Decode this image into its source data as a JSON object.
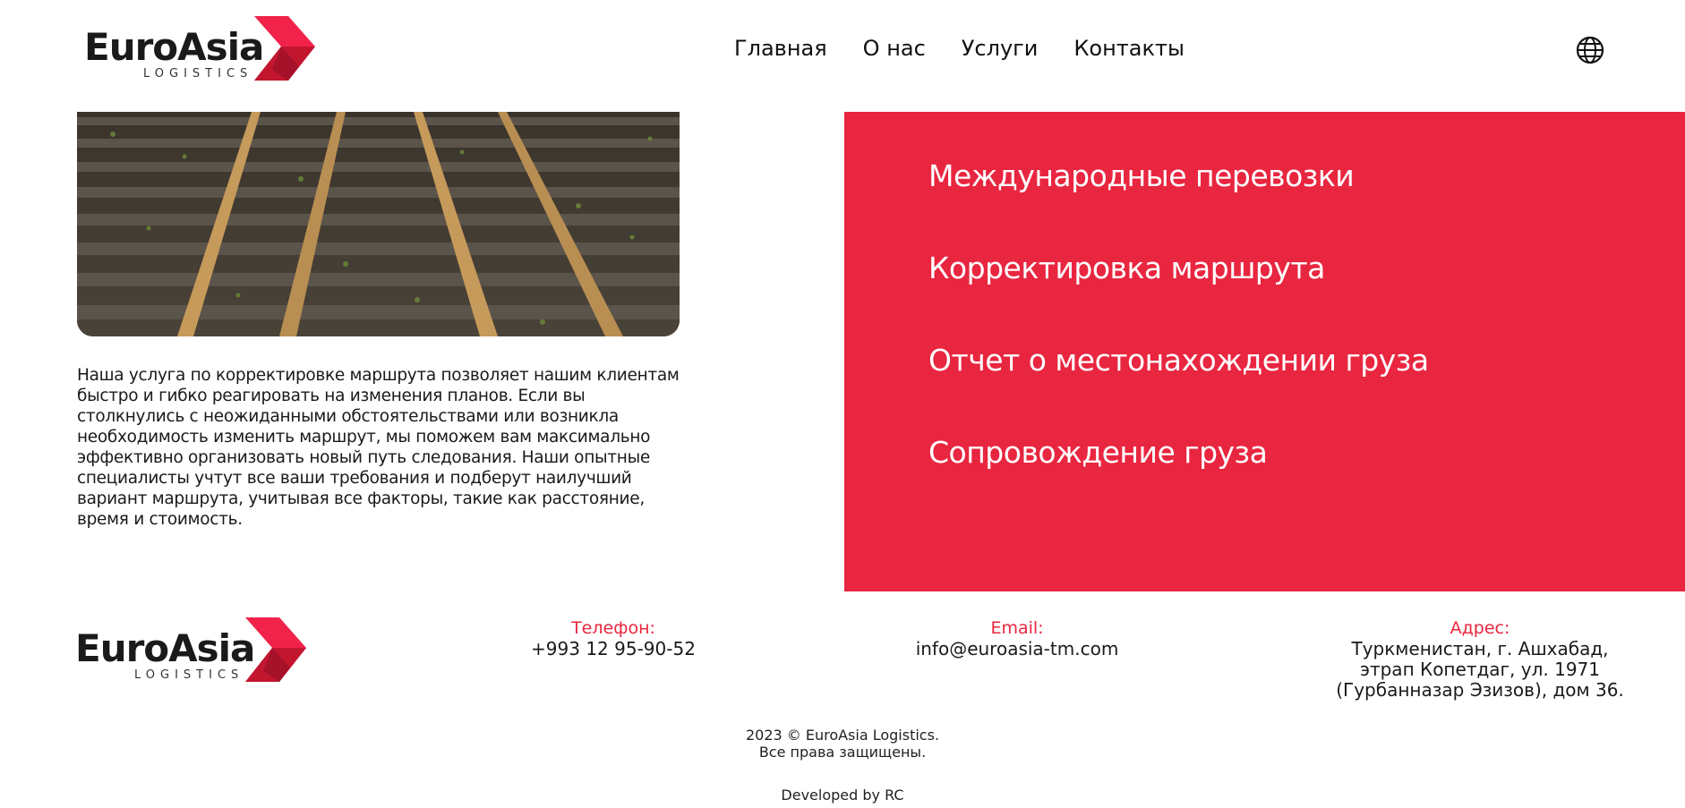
{
  "header": {
    "logo": {
      "word": "EuroAsia",
      "sub": "LOGISTICS"
    },
    "nav": [
      "Главная",
      "О нас",
      "Услуги",
      "Контакты"
    ]
  },
  "icons": {
    "language": "globe-icon",
    "logo_mark": "chevron-arrow-icon"
  },
  "colors": {
    "accent": "#e92640",
    "text": "#1a1a1a",
    "background": "#ffffff"
  },
  "main": {
    "description_lines": [
      "Наша услуга по корректировке маршрута позволяет нашим клиентам",
      "быстро и гибко реагировать на изменения планов. Если вы",
      "столкнулись с неожиданными обстоятельствами или возникла",
      "необходимость изменить маршрут, мы поможем вам максимально",
      "эффективно организовать новый путь следования. Наши опытные",
      "специалисты учтут все ваши требования и подберут наилучший",
      "вариант маршрута, учитывая все факторы, такие как расстояние,",
      "время и стоимость."
    ],
    "services": [
      "Международные перевозки",
      "Корректировка маршрута",
      "Отчет о местонахождении груза",
      "Сопровождение груза"
    ]
  },
  "footer": {
    "logo": {
      "word": "EuroAsia",
      "sub": "LOGISTICS"
    },
    "phone_label": "Телефон:",
    "phone": "+993 12 95-90-52",
    "email_label": "Email:",
    "email": "info@euroasia-tm.com",
    "address_label": "Адрес:",
    "address_lines": [
      "Туркменистан, г. Ашхабад,",
      "этрап Копетдаг, ул. 1971",
      "(Гурбанназар Эзизов), дом 36."
    ],
    "copyright_lines": [
      "2023 © EuroAsia Logistics.",
      "Все права защищены."
    ],
    "developed_by": "Developed by RC"
  }
}
